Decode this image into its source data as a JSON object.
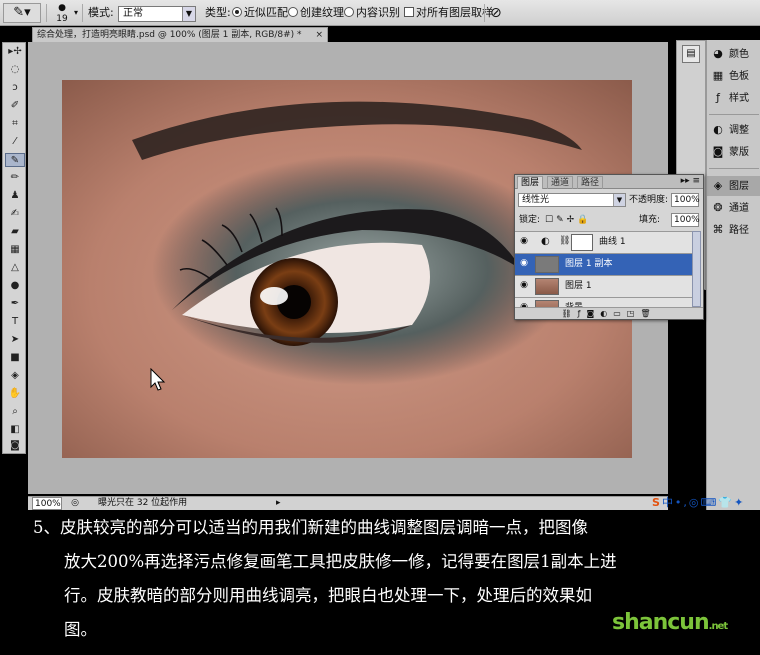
{
  "options_bar": {
    "brush_size": "19",
    "mode_label": "模式:",
    "mode_value": "正常",
    "type_label": "类型:",
    "type_options": [
      "近似匹配",
      "创建纹理",
      "内容识别"
    ],
    "type_selected": "近似匹配",
    "sample_all_label": "对所有图层取样"
  },
  "document_tab": {
    "title": "综合处理，打造明亮眼睛.psd @ 100% (图层 1 副本, RGB/8#) *",
    "close_glyph": "×"
  },
  "status_bar": {
    "zoom": "100%",
    "info": "曝光只在 32 位起作用"
  },
  "right_panels": [
    {
      "label": "颜色",
      "icon": "color-icon"
    },
    {
      "label": "色板",
      "icon": "swatches-icon"
    },
    {
      "label": "样式",
      "icon": "styles-icon"
    },
    {
      "label": "调整",
      "icon": "adjustments-icon"
    },
    {
      "label": "蒙版",
      "icon": "masks-icon"
    },
    {
      "label": "图层",
      "icon": "layers-icon",
      "selected": true
    },
    {
      "label": "通道",
      "icon": "channels-icon"
    },
    {
      "label": "路径",
      "icon": "paths-icon"
    }
  ],
  "layers_panel": {
    "tabs": [
      "图层",
      "通道",
      "路径"
    ],
    "active_tab": "图层",
    "blend_mode": "线性光",
    "opacity_label": "不透明度:",
    "opacity": "100%",
    "lock_label": "锁定:",
    "fill_label": "填充:",
    "fill": "100%",
    "layers": [
      {
        "name": "曲线 1",
        "kind": "adjustment"
      },
      {
        "name": "图层 1 副本",
        "kind": "pixel-gray",
        "selected": true
      },
      {
        "name": "图层 1",
        "kind": "photo"
      },
      {
        "name": "背景",
        "kind": "photo"
      }
    ]
  },
  "caption": {
    "lines": [
      "5、皮肤较亮的部分可以适当的用我们新建的曲线调整图层调暗一点，把图像",
      "放大200%再选择污点修复画笔工具把皮肤修一修，记得要在图层1副本上进",
      "行。皮肤教暗的部分则用曲线调亮，把眼白也处理一下，处理后的效果如",
      "图。"
    ]
  },
  "watermark": {
    "text": "shancun",
    "suffix": ".net"
  },
  "colors": {
    "selected_layer": "#3463b6",
    "caption_bg": "#000000",
    "watermark": "#7cc43a"
  }
}
